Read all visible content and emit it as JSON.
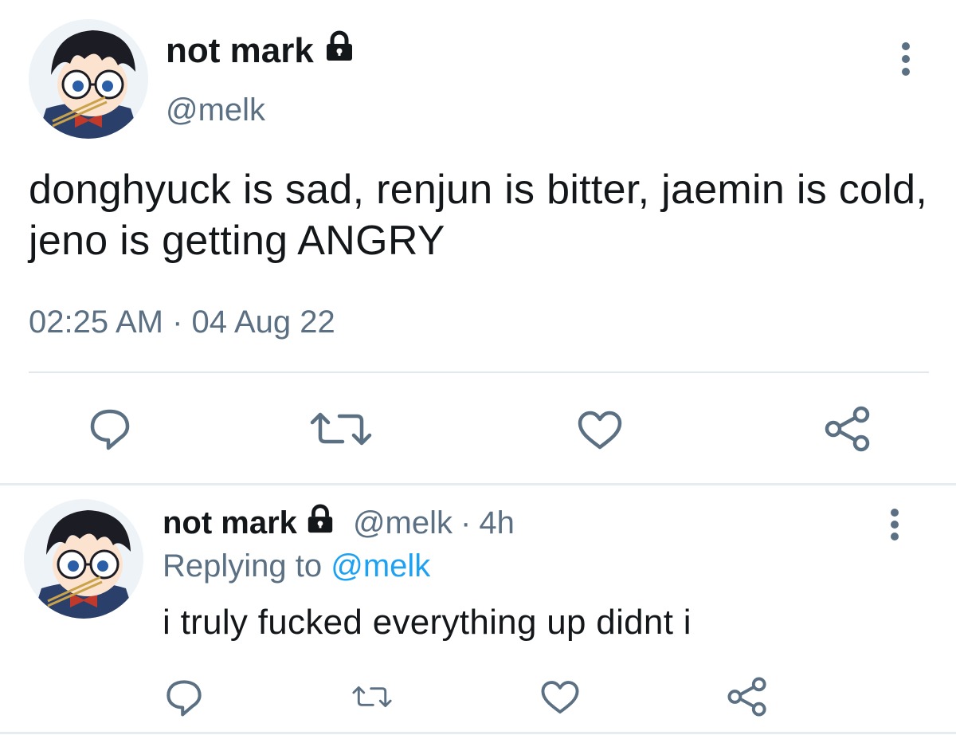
{
  "main_tweet": {
    "display_name": "not mark",
    "handle": "@melk",
    "text": "donghyuck is sad, renjun is bitter, jaemin is cold, jeno is getting ANGRY",
    "timestamp": "02:25 AM · 04 Aug 22",
    "icons": [
      "lock-icon",
      "more-vertical-icon",
      "reply-icon",
      "retweet-icon",
      "like-icon",
      "share-icon"
    ]
  },
  "reply_tweet": {
    "display_name": "not mark",
    "handle": "@melk",
    "separator": "·",
    "time": "4h",
    "replying_to_label": "Replying to",
    "replying_to_handle": "@melk",
    "text": "i truly fucked everything up didnt i",
    "icons": [
      "lock-icon",
      "more-vertical-icon",
      "reply-icon",
      "retweet-icon",
      "like-icon",
      "share-icon"
    ]
  },
  "colors": {
    "text_primary": "#14171a",
    "text_secondary": "#5b7083",
    "link": "#1da1f2",
    "divider": "#e1e8ed"
  }
}
